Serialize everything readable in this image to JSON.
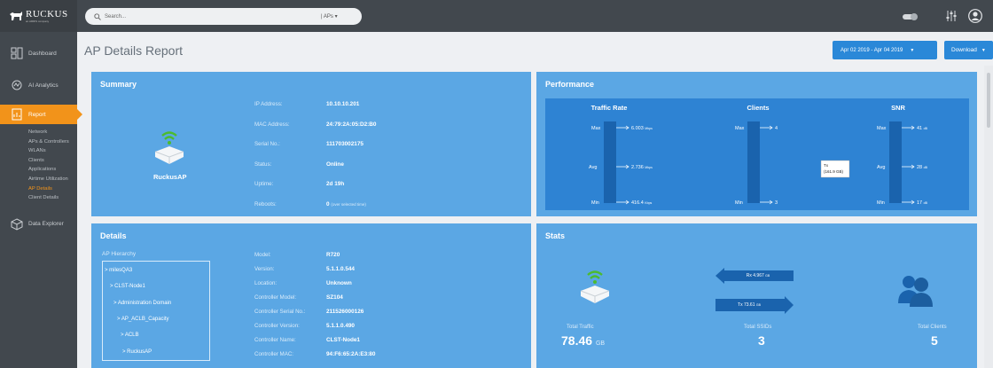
{
  "app": {
    "brand": "RUCKUS",
    "brand_sub": "an ARRIS company"
  },
  "topbar": {
    "search_placeholder": "Search...",
    "search_scope": "APs"
  },
  "sidebar": {
    "items": [
      {
        "label": "Dashboard",
        "icon": "dashboard-icon"
      },
      {
        "label": "AI Analytics",
        "icon": "ai-analytics-icon"
      },
      {
        "label": "Report",
        "icon": "report-icon"
      },
      {
        "label": "Data Explorer",
        "icon": "data-explorer-icon"
      }
    ],
    "report_sub": [
      "Network",
      "APs & Controllers",
      "WLANs",
      "Clients",
      "Applications",
      "Airtime Utilization",
      "AP Details",
      "Client Details"
    ],
    "current_sub": "AP Details"
  },
  "page": {
    "title": "AP Details Report",
    "date_range": "Apr 02 2019 - Apr 04 2019",
    "download_label": "Download"
  },
  "summary": {
    "title": "Summary",
    "ap_name": "RuckusAP",
    "fields": [
      {
        "label": "IP Address:",
        "value": "10.10.10.201"
      },
      {
        "label": "MAC Address:",
        "value": "24:79:2A:05:D2:B0"
      },
      {
        "label": "Serial No.:",
        "value": "111703002175"
      },
      {
        "label": "Status:",
        "value": "Online"
      },
      {
        "label": "Uptime:",
        "value": "2d 19h"
      },
      {
        "label": "Reboots:",
        "value": "0"
      }
    ],
    "reboots_note": "(over selected time)"
  },
  "performance": {
    "title": "Performance",
    "columns": [
      {
        "title": "Traffic Rate",
        "max": "6.003",
        "avg": "2.736",
        "min": "416.4",
        "unit_max": "Mbps",
        "unit_avg": "Mbps",
        "unit_min": "Kbps"
      },
      {
        "title": "Clients",
        "max": "4",
        "avg": "",
        "min": "3",
        "unit_max": "",
        "unit_avg": "",
        "unit_min": ""
      },
      {
        "title": "SNR",
        "max": "41",
        "avg": "28",
        "min": "17",
        "unit_max": "dB",
        "unit_avg": "dB",
        "unit_min": "dB"
      }
    ],
    "row_labels": {
      "max": "Max",
      "avg": "Avg",
      "min": "Min"
    },
    "tooltip_line1": "Tx",
    "tooltip_line2": "(161.9 GB)"
  },
  "details": {
    "title": "Details",
    "hierarchy_label": "AP Hierarchy",
    "hierarchy": [
      "> milesQA3",
      "> CLST-Node1",
      "> Administration Domain",
      "> AP_ACLB_Capacity",
      "> ACLB",
      "> RuckusAP"
    ],
    "fields": [
      {
        "label": "Model:",
        "value": "R720"
      },
      {
        "label": "Version:",
        "value": "5.1.1.0.544"
      },
      {
        "label": "Location:",
        "value": "Unknown"
      },
      {
        "label": "Controller Model:",
        "value": "SZ104"
      },
      {
        "label": "Controller Serial No.:",
        "value": "211526000126"
      },
      {
        "label": "Controller Version:",
        "value": "5.1.1.0.490"
      },
      {
        "label": "Controller Name:",
        "value": "CLST-Node1"
      },
      {
        "label": "Controller MAC:",
        "value": "94:F6:65:2A:E3:80"
      }
    ]
  },
  "stats": {
    "title": "Stats",
    "rx_label": "Rx 4.967",
    "rx_unit": "GB",
    "tx_label": "Tx 73.61",
    "tx_unit": "GB",
    "total_traffic_label": "Total Traffic",
    "total_traffic_value": "78.46",
    "total_traffic_unit": "GB",
    "total_ssids_label": "Total SSIDs",
    "total_ssids_value": "3",
    "total_clients_label": "Total Clients",
    "total_clients_value": "5"
  },
  "colors": {
    "sidebar_bg": "#42484e",
    "accent_orange": "#f2931a",
    "panel_blue": "#5ba7e4",
    "perf_bg": "#2e83d3",
    "bar_dark": "#1a63ad",
    "button_blue": "#2a88d8"
  }
}
